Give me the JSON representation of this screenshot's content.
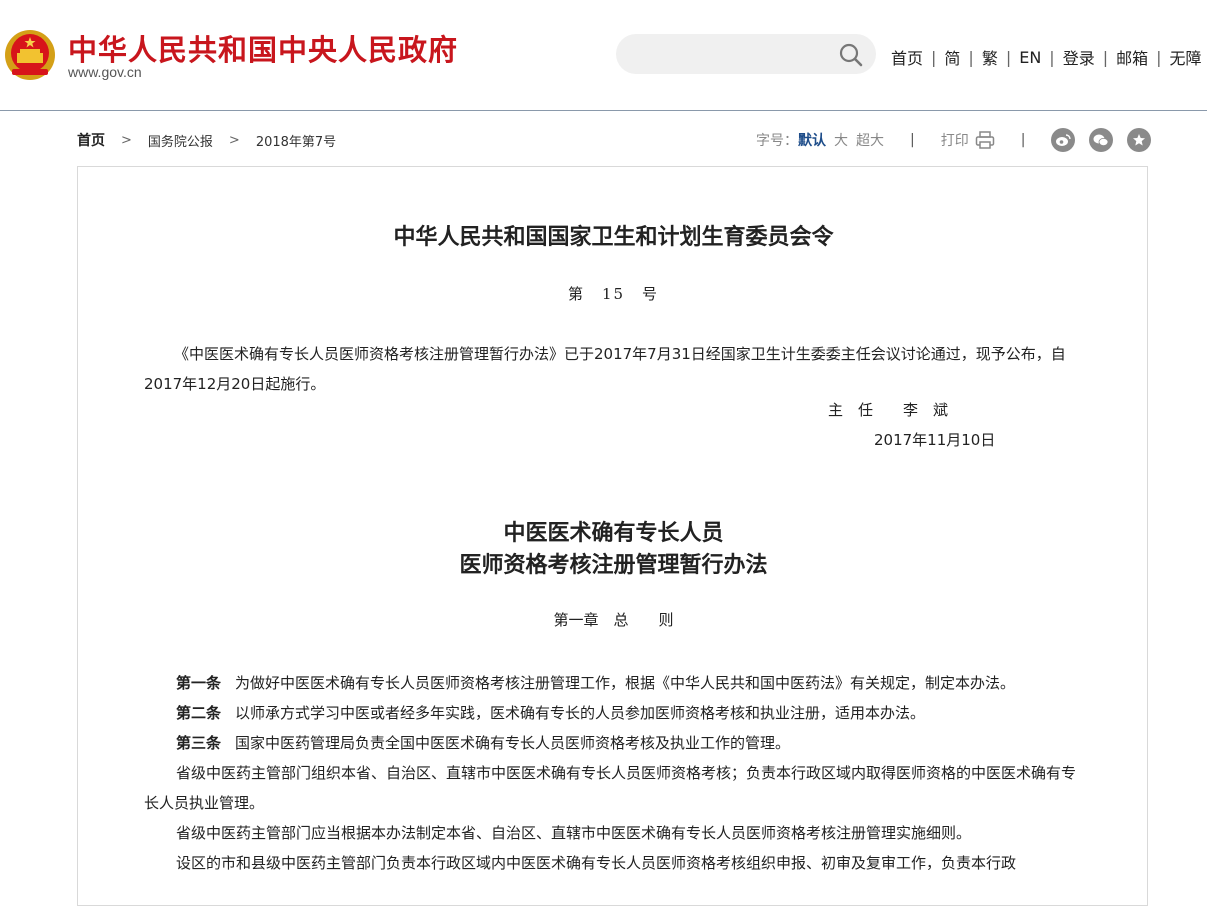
{
  "header": {
    "site_title": "中华人民共和国中央人民政府",
    "site_url": "www.gov.cn",
    "search_placeholder": "",
    "links": [
      "首页",
      "简",
      "繁",
      "EN",
      "登录",
      "邮箱",
      "无障"
    ]
  },
  "breadcrumb": {
    "home": "首页",
    "level1": "国务院公报",
    "level2": "2018年第7号"
  },
  "tools": {
    "font_label": "字号：",
    "font_default": "默认",
    "font_large": "大",
    "font_xlarge": "超大",
    "print_label": "打印",
    "share_icons": [
      "weibo-icon",
      "wechat-icon",
      "favorite-icon"
    ]
  },
  "article": {
    "title": "中华人民共和国国家卫生和计划生育委员会令",
    "number": "第　15　号",
    "intro": "《中医医术确有专长人员医师资格考核注册管理暂行办法》已于2017年7月31日经国家卫生计生委委主任会议讨论通过，现予公布，自2017年12月20日起施行。",
    "signer": "主　任　　李　斌",
    "date": "2017年11月10日",
    "subtitle_line1": "中医医术确有专长人员",
    "subtitle_line2": "医师资格考核注册管理暂行办法",
    "chapter": "第一章　总　　则",
    "articles": [
      {
        "label": "第一条",
        "text": "为做好中医医术确有专长人员医师资格考核注册管理工作，根据《中华人民共和国中医药法》有关规定，制定本办法。"
      },
      {
        "label": "第二条",
        "text": "以师承方式学习中医或者经多年实践，医术确有专长的人员参加医师资格考核和执业注册，适用本办法。"
      },
      {
        "label": "第三条",
        "text": "国家中医药管理局负责全国中医医术确有专长人员医师资格考核及执业工作的管理。"
      }
    ],
    "paragraphs": [
      "省级中医药主管部门组织本省、自治区、直辖市中医医术确有专长人员医师资格考核；负责本行政区域内取得医师资格的中医医术确有专长人员执业管理。",
      "省级中医药主管部门应当根据本办法制定本省、自治区、直辖市中医医术确有专长人员医师资格考核注册管理实施细则。",
      "设区的市和县级中医药主管部门负责本行政区域内中医医术确有专长人员医师资格考核组织申报、初审及复审工作，负责本行政"
    ]
  },
  "colors": {
    "brand_red": "#c8161d",
    "link_blue": "#1e4d8a",
    "header_line": "#8a99ab"
  }
}
